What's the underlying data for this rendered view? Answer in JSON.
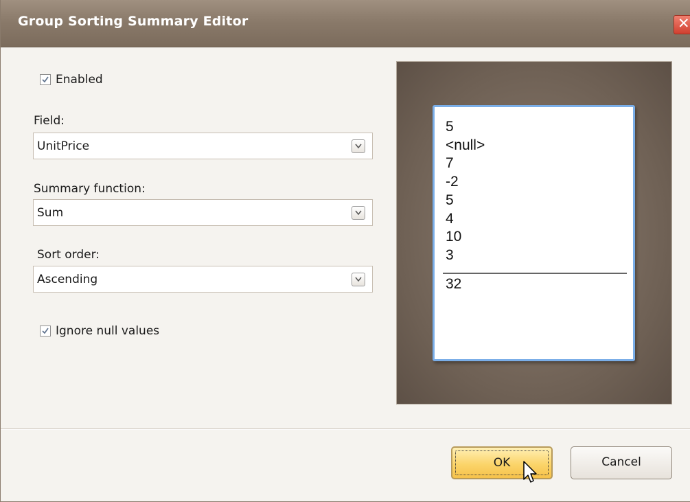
{
  "window": {
    "title": "Group Sorting Summary Editor",
    "close_symbol": "✕"
  },
  "form": {
    "enabled": {
      "label": "Enabled",
      "checked": true
    },
    "field": {
      "label": "Field:",
      "value": "UnitPrice"
    },
    "summary_function": {
      "label": "Summary function:",
      "value": "Sum"
    },
    "sort_order": {
      "label": "Sort order:",
      "value": "Ascending"
    },
    "ignore_null": {
      "label": "Ignore null values",
      "checked": true
    }
  },
  "preview": {
    "values": [
      "5",
      "<null>",
      "7",
      "-2",
      "5",
      "4",
      "10",
      "3"
    ],
    "total": "32"
  },
  "buttons": {
    "ok": "OK",
    "cancel": "Cancel"
  },
  "colors": {
    "titlebar": "#8a7a6a",
    "preview_background": "#6e6054",
    "preview_border": "#7aaee8",
    "ok_button": "#fbd46a"
  }
}
